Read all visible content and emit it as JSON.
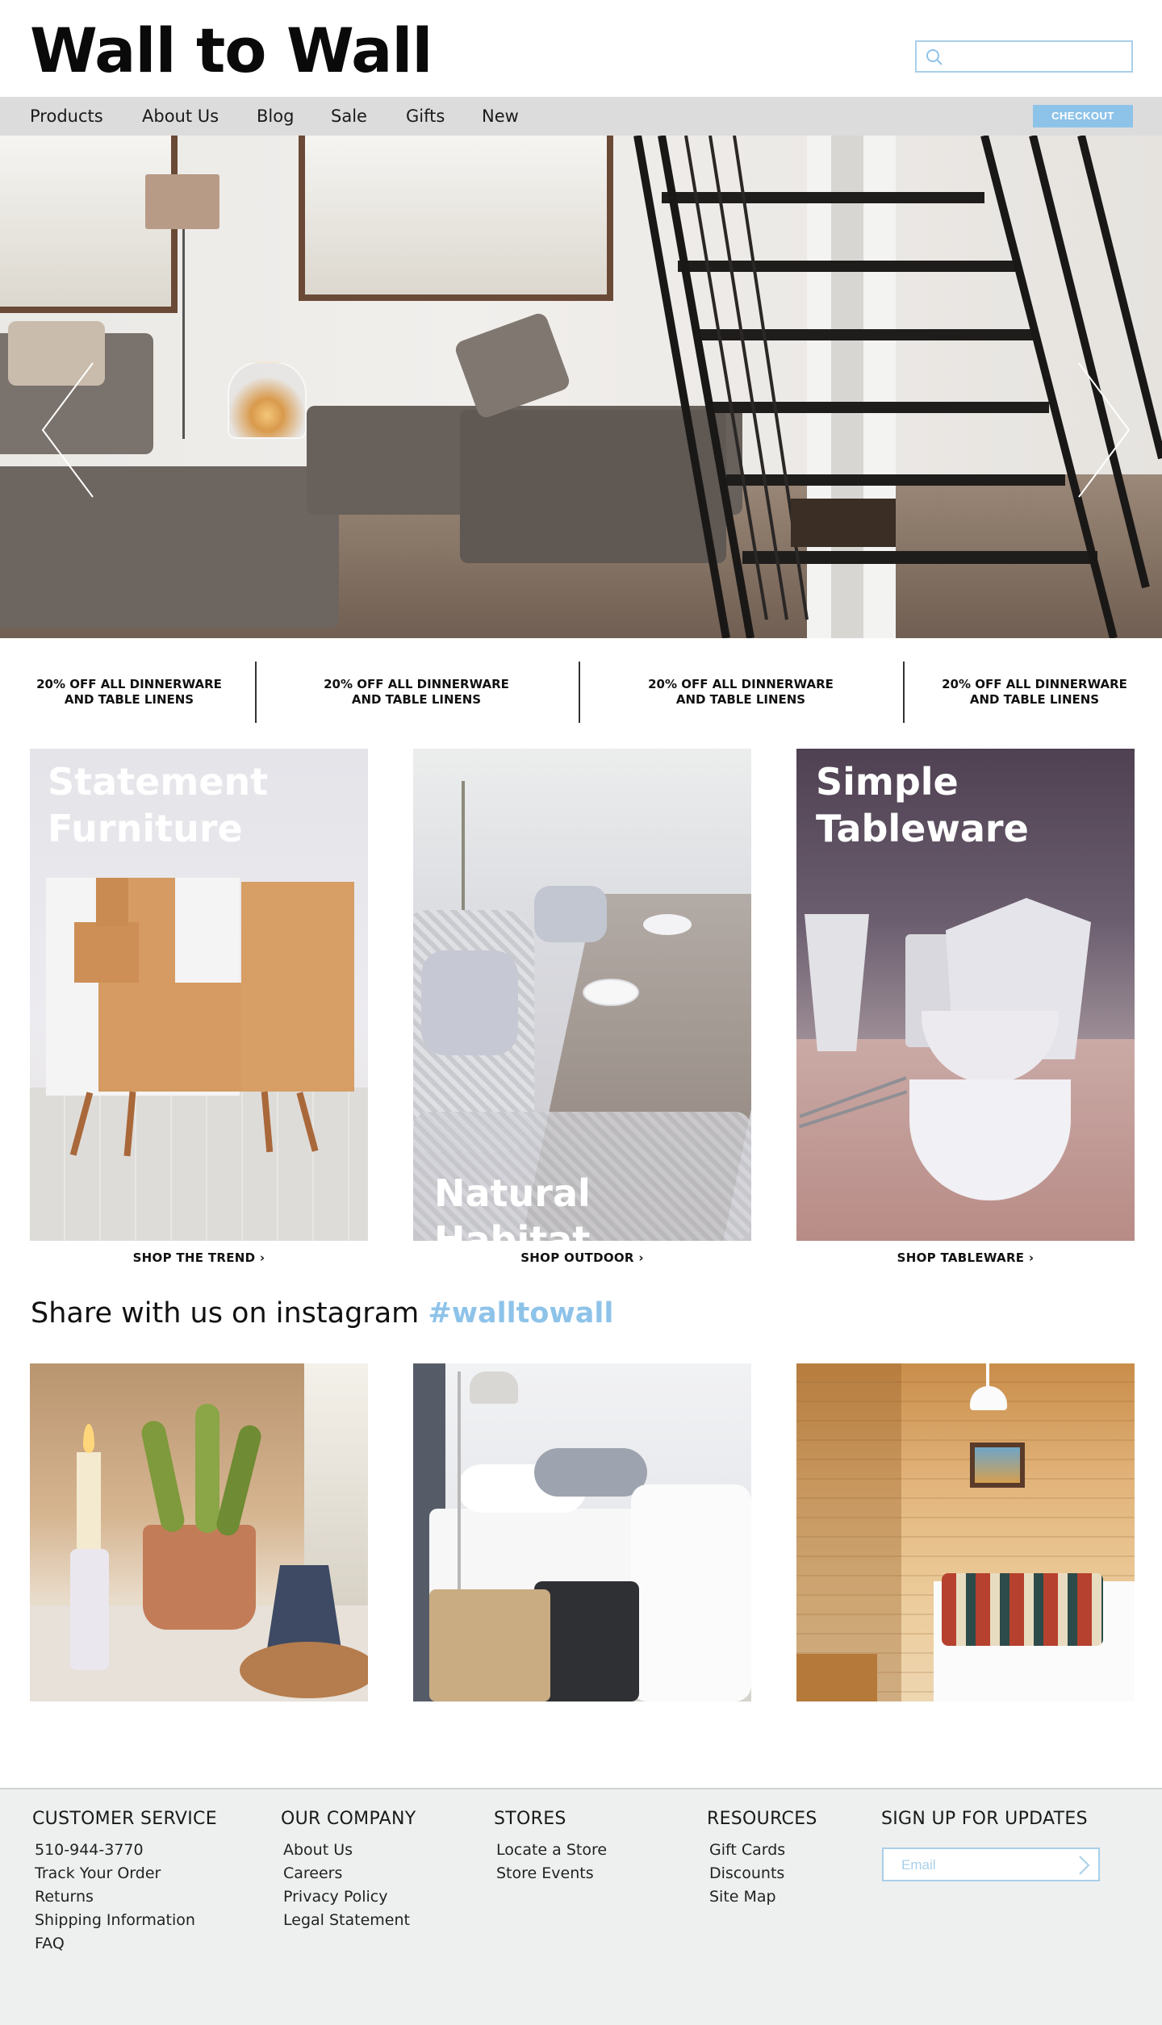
{
  "brand": {
    "logo": "Wall to Wall",
    "accent": "#8ec3e9"
  },
  "search": {
    "placeholder": "",
    "icon": "search-icon"
  },
  "nav": {
    "items": [
      {
        "label": "Products"
      },
      {
        "label": "About Us"
      },
      {
        "label": "Blog"
      },
      {
        "label": "Sale"
      },
      {
        "label": "Gifts"
      },
      {
        "label": "New"
      }
    ],
    "checkout_label": "CHECKOUT"
  },
  "hero": {
    "prev_icon": "chevron-left-icon",
    "next_icon": "chevron-right-icon"
  },
  "promos": [
    {
      "line1": "20% OFF ALL  DINNERWARE",
      "line2": "AND TABLE LINENS"
    },
    {
      "line1": "20% OFF ALL  DINNERWARE",
      "line2": "AND TABLE LINENS"
    },
    {
      "line1": "20% OFF ALL  DINNERWARE",
      "line2": "AND TABLE LINENS"
    },
    {
      "line1": "20% OFF ALL  DINNERWARE",
      "line2": "AND TABLE LINENS"
    }
  ],
  "features": [
    {
      "title_line1": "Statement",
      "title_line2": "Furniture",
      "link": "SHOP THE TREND"
    },
    {
      "title_line1": "Natural Habitat",
      "title_line2": "",
      "link": "SHOP OUTDOOR"
    },
    {
      "title_line1": "Simple",
      "title_line2": "Tableware",
      "link": "SHOP TABLEWARE"
    }
  ],
  "instagram": {
    "heading": "Share with us on instagram",
    "hashtag": "#walltowall"
  },
  "footer": {
    "customer_service": {
      "heading": "CUSTOMER SERVICE",
      "links": [
        "510-944-3770",
        "Track Your Order",
        "Returns",
        "Shipping Information",
        "FAQ"
      ]
    },
    "our_company": {
      "heading": "OUR COMPANY",
      "links": [
        "About Us",
        "Careers",
        "Privacy Policy",
        "Legal Statement"
      ]
    },
    "stores": {
      "heading": "STORES",
      "links": [
        "Locate a Store",
        "Store Events"
      ]
    },
    "resources": {
      "heading": "RESOURCES",
      "links": [
        "Gift Cards",
        "Discounts",
        "Site Map"
      ]
    },
    "signup": {
      "heading": "SIGN UP FOR UPDATES",
      "email_placeholder": "Email"
    }
  }
}
